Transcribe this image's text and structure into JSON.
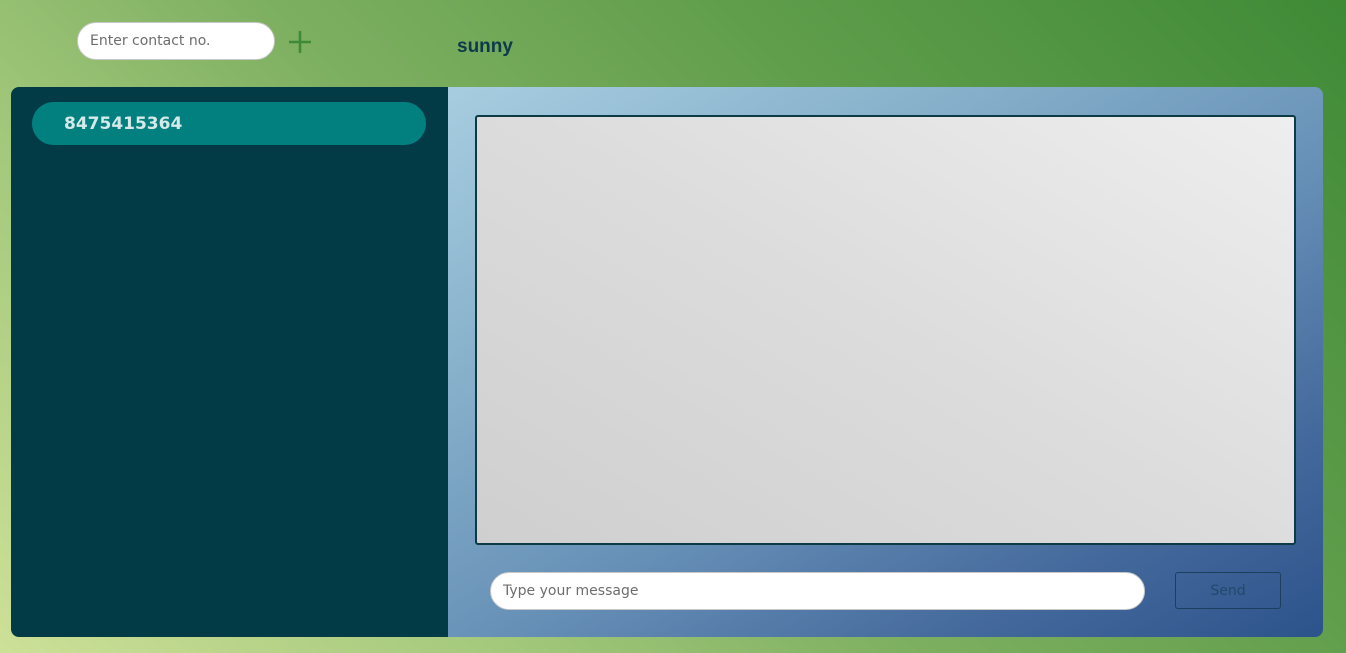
{
  "header": {
    "contact_input_placeholder": "Enter contact no.",
    "add_icon": "plus-icon",
    "current_user": "sunny"
  },
  "sidebar": {
    "contacts": [
      {
        "label": "8475415364",
        "active": true
      }
    ]
  },
  "chat": {
    "message_placeholder": "Type your message",
    "send_label": "Send"
  },
  "colors": {
    "sidebar_bg": "#023a46",
    "contact_active_bg": "#02807f",
    "accent_green": "#3f8a36",
    "user_name": "#0d3a4b"
  }
}
